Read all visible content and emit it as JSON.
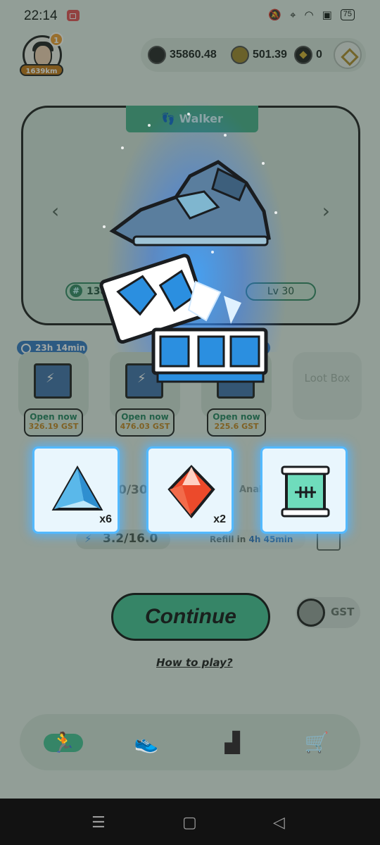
{
  "status_bar": {
    "time": "22:14",
    "icons": [
      "screen-record-icon",
      "mute-icon",
      "location-icon",
      "wifi-icon",
      "sim-icon"
    ],
    "battery": "75"
  },
  "header": {
    "notification_count": "1",
    "distance": "1639km",
    "balances": [
      {
        "icon": "gst-sneaker-coin-icon",
        "value": "35860.48"
      },
      {
        "icon": "gmt-coin-icon",
        "value": "501.39"
      },
      {
        "icon": "bnb-coin-icon",
        "value": "0"
      }
    ]
  },
  "sneaker": {
    "type": "Walker",
    "id": "13855",
    "level": "Lv 30"
  },
  "mystery_boxes": {
    "timer": "23h 14min",
    "slots": [
      {
        "button": "Open now",
        "price": "326.19 GST"
      },
      {
        "button": "Open now",
        "price": "476.03 GST"
      },
      {
        "button": "Open now",
        "price": "225.6 GST"
      }
    ],
    "loot_box_label": "Loot Box"
  },
  "stats": {
    "durability_partial": "0/30",
    "anal_partial": "Anal",
    "energy": "3.2/16.0",
    "refill_prefix": "Refill in",
    "refill_time": "4h 45min"
  },
  "actions": {
    "continue": "Continue",
    "gst_toggle": "GST",
    "how_to_play": "How to play?"
  },
  "rewards": [
    {
      "icon": "blue-gem-icon",
      "count": "x6",
      "color": "#5ab8ea"
    },
    {
      "icon": "red-gem-icon",
      "count": "x2",
      "color": "#ec4a2b"
    },
    {
      "icon": "scroll-icon",
      "count": "",
      "color": "#6fdcbc"
    }
  ],
  "colors": {
    "accent_green": "#4ec79a",
    "glow_blue": "#53b9ff",
    "box_blue": "#3d7fc7"
  }
}
